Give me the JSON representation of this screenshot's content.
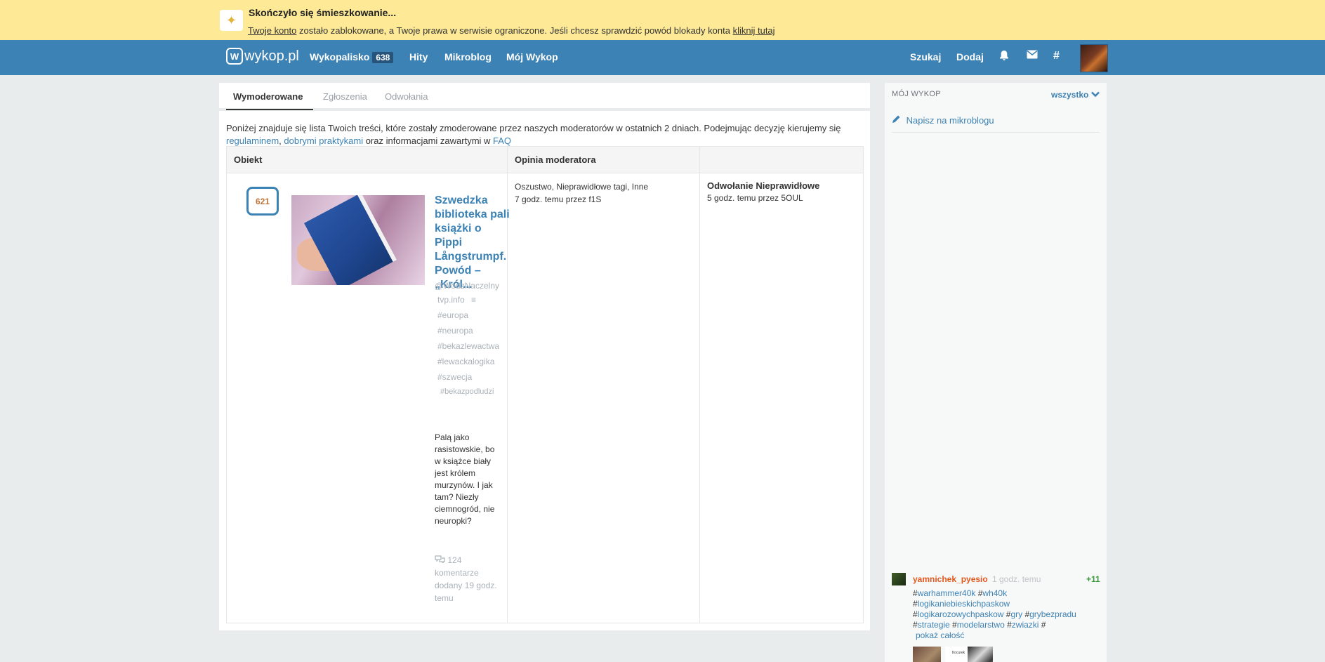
{
  "banner": {
    "title": "Skończyło się śmieszkowanie...",
    "link_account": "Twoje konto",
    "text_middle": " zostało zablokowane, a Twoje prawa w serwisie ograniczone. Jeśli chcesz sprawdzić powód blokady konta ",
    "link_click": "kliknij tutaj"
  },
  "nav": {
    "logo": "wykop.pl",
    "logo_mark": "W",
    "wykopalisko": "Wykopalisko",
    "wykopalisko_count": "638",
    "hity": "Hity",
    "mikroblog": "Mikroblog",
    "moj_wykop": "Mój Wykop",
    "szukaj": "Szukaj",
    "dodaj": "Dodaj",
    "hash": "#"
  },
  "tabs": [
    "Wymoderowane",
    "Zgłoszenia",
    "Odwołania"
  ],
  "intro": {
    "text1": "Poniżej znajduje się lista Twoich treści, które zostały zmoderowane przez naszych moderatorów w ostatnich 2 dniach. Podejmując decyzję kierujemy się ",
    "link_rules": "regulaminem",
    "sep": ", ",
    "link_practices": "dobrymi praktykami",
    "text2": " oraz informacjami zawartymi w ",
    "link_faq": "FAQ"
  },
  "table": {
    "headers": [
      "Obiekt",
      "Opinia moderatora",
      ""
    ],
    "row": {
      "votes": "621",
      "title": "Szwedzka biblioteka pali książki o Pippi Långstrumpf. Powód – „Król...",
      "author": "@WodzNaczelny",
      "source": "tvp.info",
      "tags": [
        "#europa",
        "#neuropa",
        "#bekazlewactwa",
        "#lewackalogika",
        "#szwecja",
        "#bekazpodludzi"
      ],
      "description": "Palą jako rasistowskie, bo w książce biały jest królem murzynów. I jak tam? Niezły ciemnogród, nie neuropki?",
      "comments": "124 komentarze",
      "added": "dodany 19 godz. temu",
      "mod_reason": "Oszustwo, Nieprawidłowe tagi, Inne",
      "mod_when": "7 godz. temu przez f1S",
      "appeal_title": "Odwołanie Nieprawidłowe",
      "appeal_when": "5 godz. temu przez 5OUL"
    }
  },
  "sidebar": {
    "header": "MÓJ WYKOP",
    "filter": "wszystko",
    "write": "Napisz na mikroblogu",
    "entry": {
      "user": "yamnichek_pyesio",
      "time": "1 godz. temu",
      "votes": "+11",
      "tags": [
        "warhammer40k",
        "wh40k",
        "logikaniebieskichpaskow",
        "logikarozowychpaskow",
        "gry",
        "grybezpradu",
        "strategie",
        "modelarstwo",
        "zwiazki"
      ],
      "show_more": "pokaż całość",
      "mini_label": "Kocurek"
    }
  },
  "colors": {
    "banner_bg": "#fde996",
    "nav_bg": "#3c82b4",
    "link": "#3c82b4",
    "vote_text": "#c0753a",
    "user_orange": "#e2591e",
    "plus_green": "#3c9a3c"
  }
}
